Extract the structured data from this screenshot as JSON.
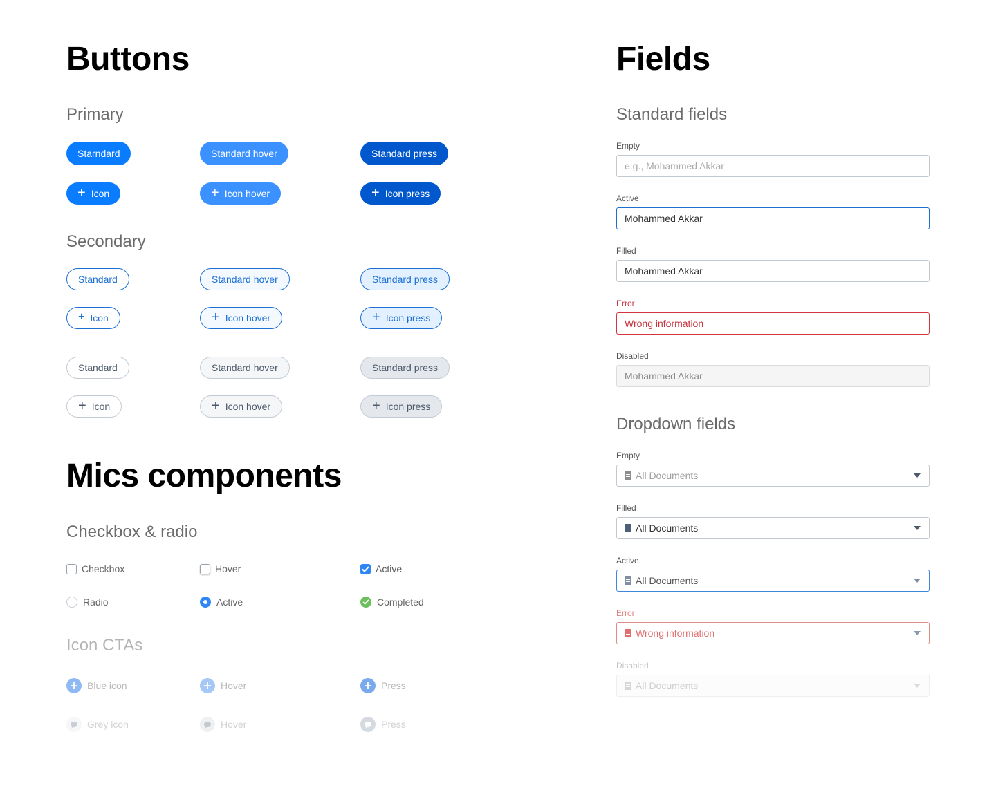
{
  "buttons": {
    "title": "Buttons",
    "primary": {
      "title": "Primary",
      "standard": "Starndard",
      "standard_hover": "Standard hover",
      "standard_press": "Standard press",
      "icon": "Icon",
      "icon_hover": "Icon hover",
      "icon_press": "Icon press"
    },
    "secondary": {
      "title": "Secondary",
      "blue": {
        "standard": "Standard",
        "standard_hover": "Standard hover",
        "standard_press": "Standard press",
        "icon": "Icon",
        "icon_hover": "Icon hover",
        "icon_press": "Icon press"
      },
      "grey": {
        "standard": "Standard",
        "standard_hover": "Standard hover",
        "standard_press": "Standard press",
        "icon": "Icon",
        "icon_hover": "Icon hover",
        "icon_press": "Icon press"
      }
    },
    "plus_glyph": "+"
  },
  "misc": {
    "title": "Mics components",
    "checkbox_radio": {
      "title": "Checkbox & radio",
      "checkbox": "Checkbox",
      "checkbox_hover": "Hover",
      "checkbox_active": "Active",
      "radio": "Radio",
      "radio_active": "Active",
      "radio_completed": "Completed"
    },
    "icon_ctas": {
      "title": "Icon CTAs",
      "blue_icon": "Blue icon",
      "blue_hover": "Hover",
      "blue_press": "Press",
      "grey_icon": "Grey icon",
      "grey_hover": "Hover",
      "grey_press": "Press"
    }
  },
  "fields": {
    "title": "Fields",
    "standard": {
      "title": "Standard fields",
      "empty_label": "Empty",
      "empty_placeholder": "e.g., Mohammed Akkar",
      "active_label": "Active",
      "active_value": "Mohammed Akkar",
      "filled_label": "Filled",
      "filled_value": "Mohammed Akkar",
      "error_label": "Error",
      "error_value": "Wrong information",
      "disabled_label": "Disabled",
      "disabled_value": "Mohammed Akkar"
    },
    "dropdown": {
      "title": "Dropdown fields",
      "empty_label": "Empty",
      "empty_value": "All Documents",
      "filled_label": "Filled",
      "filled_value": "All Documents",
      "active_label": "Active",
      "active_value": "All Documents",
      "error_label": "Error",
      "error_value": "Wrong information",
      "disabled_label": "Disabled",
      "disabled_value": "All Documents"
    }
  },
  "colors": {
    "primary": "#0a7cff",
    "primary_hover": "#3b91ff",
    "primary_press": "#0058cc",
    "secondary_text": "#1b6fd3",
    "grey_text": "#4c5a6b",
    "error": "#d3353f",
    "success": "#6cbf5c"
  }
}
